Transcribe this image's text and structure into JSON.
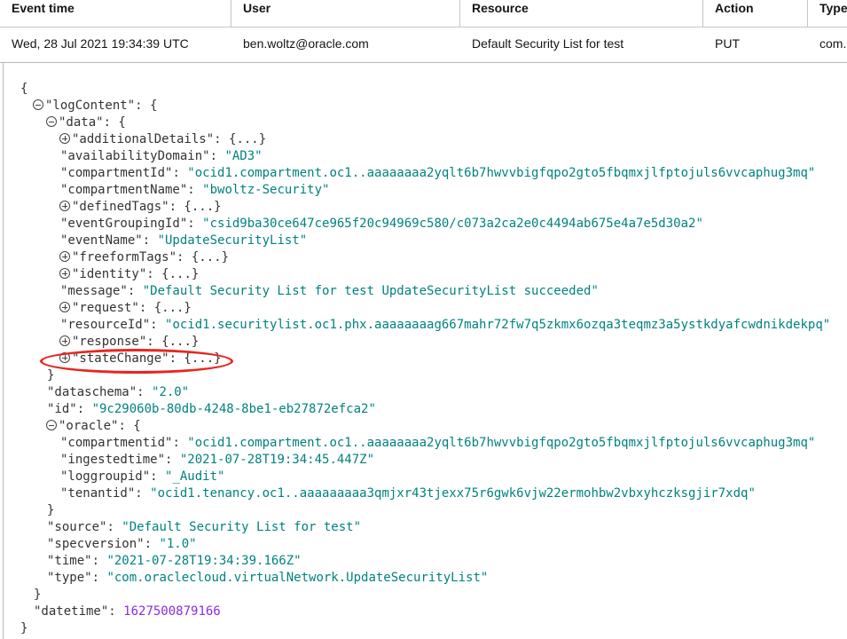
{
  "table": {
    "headers": [
      "Event time",
      "User",
      "Resource",
      "Action",
      "Type"
    ],
    "row": [
      "Wed, 28 Jul 2021 19:34:39 UTC",
      "ben.woltz@oracle.com",
      "Default Security List for test",
      "PUT",
      "com.oraclecloud.virtualNetwork.UpdateSecurityList"
    ]
  },
  "json_lines": [
    {
      "indent": 0,
      "text": "{"
    },
    {
      "indent": 1,
      "toggle": "minus",
      "key": "\"logContent\"",
      "punct": ": {"
    },
    {
      "indent": 2,
      "toggle": "minus",
      "key": "\"data\"",
      "punct": ": {"
    },
    {
      "indent": 3,
      "toggle": "plus",
      "key": "\"additionalDetails\"",
      "punct": ": {...}"
    },
    {
      "indent": 3,
      "key": "\"availabilityDomain\"",
      "punct": ": ",
      "value": "\"AD3\""
    },
    {
      "indent": 3,
      "key": "\"compartmentId\"",
      "punct": ": ",
      "value": "\"ocid1.compartment.oc1..aaaaaaaa2yqlt6b7hwvvbigfqpo2gto5fbqmxjlfptojuls6vvcaphug3mq\""
    },
    {
      "indent": 3,
      "key": "\"compartmentName\"",
      "punct": ": ",
      "value": "\"bwoltz-Security\""
    },
    {
      "indent": 3,
      "toggle": "plus",
      "key": "\"definedTags\"",
      "punct": ": {...}"
    },
    {
      "indent": 3,
      "key": "\"eventGroupingId\"",
      "punct": ": ",
      "value": "\"csid9ba30ce647ce965f20c94969c580/c073a2ca2e0c4494ab675e4a7e5d30a2\""
    },
    {
      "indent": 3,
      "key": "\"eventName\"",
      "punct": ": ",
      "value": "\"UpdateSecurityList\""
    },
    {
      "indent": 3,
      "toggle": "plus",
      "key": "\"freeformTags\"",
      "punct": ": {...}"
    },
    {
      "indent": 3,
      "toggle": "plus",
      "key": "\"identity\"",
      "punct": ": {...}"
    },
    {
      "indent": 3,
      "key": "\"message\"",
      "punct": ": ",
      "value": "\"Default Security List for test UpdateSecurityList succeeded\""
    },
    {
      "indent": 3,
      "toggle": "plus",
      "key": "\"request\"",
      "punct": ": {...}"
    },
    {
      "indent": 3,
      "key": "\"resourceId\"",
      "punct": ": ",
      "value": "\"ocid1.securitylist.oc1.phx.aaaaaaaag667mahr72fw7q5zkmx6ozqa3teqmz3a5ystkdyafcwdnikdekpq\""
    },
    {
      "indent": 3,
      "toggle": "plus",
      "key": "\"response\"",
      "punct": ": {...}"
    },
    {
      "indent": 3,
      "toggle": "plus",
      "key": "\"stateChange\"",
      "punct": ": {...}",
      "highlight": true
    },
    {
      "indent": 2,
      "text": "}"
    },
    {
      "indent": 2,
      "key": "\"dataschema\"",
      "punct": ": ",
      "value": "\"2.0\""
    },
    {
      "indent": 2,
      "key": "\"id\"",
      "punct": ": ",
      "value": "\"9c29060b-80db-4248-8be1-eb27872efca2\""
    },
    {
      "indent": 2,
      "toggle": "minus",
      "key": "\"oracle\"",
      "punct": ": {"
    },
    {
      "indent": 3,
      "key": "\"compartmentid\"",
      "punct": ": ",
      "value": "\"ocid1.compartment.oc1..aaaaaaaa2yqlt6b7hwvvbigfqpo2gto5fbqmxjlfptojuls6vvcaphug3mq\""
    },
    {
      "indent": 3,
      "key": "\"ingestedtime\"",
      "punct": ": ",
      "value": "\"2021-07-28T19:34:45.447Z\""
    },
    {
      "indent": 3,
      "key": "\"loggroupid\"",
      "punct": ": ",
      "value": "\"_Audit\""
    },
    {
      "indent": 3,
      "key": "\"tenantid\"",
      "punct": ": ",
      "value": "\"ocid1.tenancy.oc1..aaaaaaaaa3qmjxr43tjexx75r6gwk6vjw22ermohbw2vbxyhczksgjir7xdq\""
    },
    {
      "indent": 2,
      "text": "}"
    },
    {
      "indent": 2,
      "key": "\"source\"",
      "punct": ": ",
      "value": "\"Default Security List for test\""
    },
    {
      "indent": 2,
      "key": "\"specversion\"",
      "punct": ": ",
      "value": "\"1.0\""
    },
    {
      "indent": 2,
      "key": "\"time\"",
      "punct": ": ",
      "value": "\"2021-07-28T19:34:39.166Z\""
    },
    {
      "indent": 2,
      "key": "\"type\"",
      "punct": ": ",
      "value": "\"com.oraclecloud.virtualNetwork.UpdateSecurityList\""
    },
    {
      "indent": 1,
      "text": "}"
    },
    {
      "indent": 1,
      "key": "\"datetime\"",
      "punct": ": ",
      "number": "1627500879166"
    },
    {
      "indent": 0,
      "text": "}"
    }
  ],
  "colors": {
    "string": "#00827f",
    "number": "#8a2be2",
    "highlight": "#e8251f"
  }
}
